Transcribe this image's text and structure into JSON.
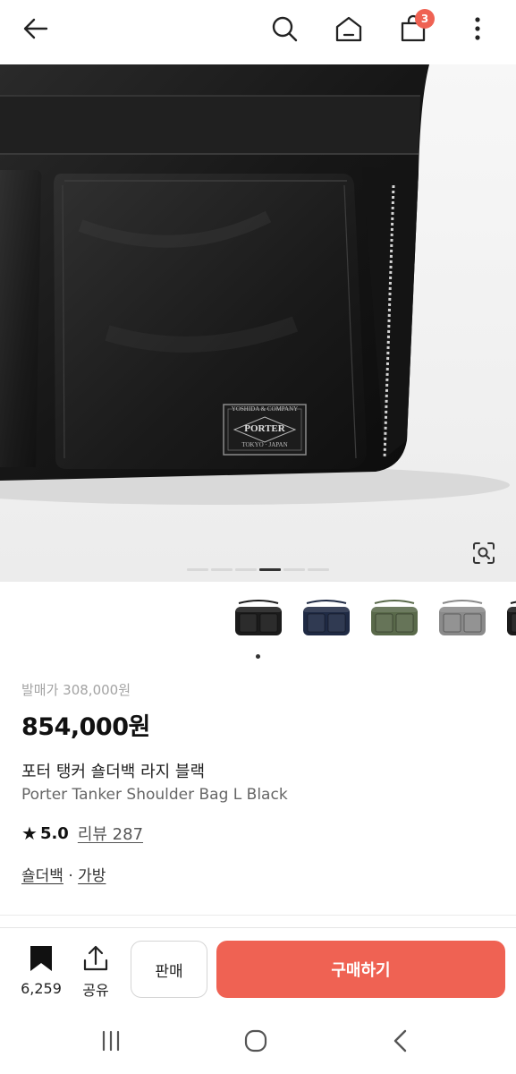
{
  "header": {
    "back_icon": "arrow-left-icon",
    "search_icon": "search-icon",
    "home_icon": "home-icon",
    "cart_icon": "shopping-bag-icon",
    "cart_badge": "3",
    "more_icon": "more-vertical-icon"
  },
  "hero": {
    "brand_label_top": "YOSHIDA & COMPANY",
    "brand_label_main": "PORTER",
    "brand_label_bottom": "TOKYO · JAPAN",
    "lens_icon": "image-search-icon",
    "slide_count": 6,
    "active_slide": 4
  },
  "thumbnails": [
    {
      "color": "#1b1b1b",
      "name": "black"
    },
    {
      "color": "#1f2a44",
      "name": "navy"
    },
    {
      "color": "#59694a",
      "name": "olive"
    },
    {
      "color": "#8a8a8a",
      "name": "silver-gray"
    },
    {
      "color": "#1b1b1b",
      "name": "black-partial"
    }
  ],
  "product": {
    "release_price": "발매가 308,000원",
    "price": "854,000원",
    "name_ko": "포터 탱커 숄더백 라지 블랙",
    "name_en": "Porter Tanker Shoulder Bag L Black",
    "rating": "5.0",
    "review_text": "리뷰 287",
    "category_1": "숄더백",
    "separator": " · ",
    "category_2": "가방"
  },
  "actions": {
    "bookmark_count": "6,259",
    "share_label": "공유",
    "sell_label": "판매",
    "buy_label": "구매하기",
    "buy_color": "#ef6253"
  },
  "system_nav": {
    "recent_icon": "recent-apps-icon",
    "home_icon": "home-circle-icon",
    "back_icon": "back-chevron-icon"
  }
}
